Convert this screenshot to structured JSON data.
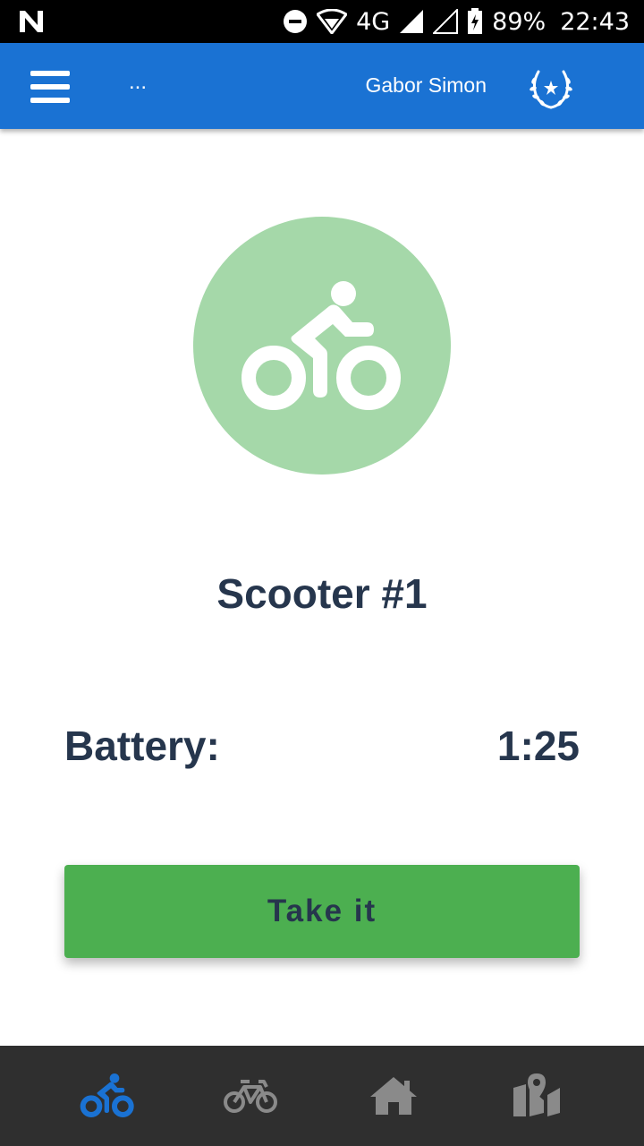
{
  "status_bar": {
    "network": "4G",
    "battery": "89%",
    "time": "22:43"
  },
  "app_bar": {
    "title": "...",
    "user_name": "Gabor Simon",
    "menu_icon": "hamburger-menu-icon",
    "award_icon": "laurel-wreath-icon"
  },
  "scooter": {
    "icon": "bike-rider-icon",
    "name": "Scooter #1",
    "battery_label": "Battery:",
    "battery_value": "1:25"
  },
  "actions": {
    "take_label": "Take it"
  },
  "bottom_nav": {
    "items": [
      {
        "icon": "bike-rider-icon",
        "active": true
      },
      {
        "icon": "bicycle-icon",
        "active": false
      },
      {
        "icon": "home-icon",
        "active": false
      },
      {
        "icon": "map-pin-icon",
        "active": false
      }
    ]
  },
  "colors": {
    "app_bar": "#1a72d3",
    "active_nav": "#1a72d3",
    "inactive_nav": "#8a8a8a",
    "button": "#4caf50",
    "hero_circle": "#a5d8a9",
    "text": "#26364d"
  }
}
